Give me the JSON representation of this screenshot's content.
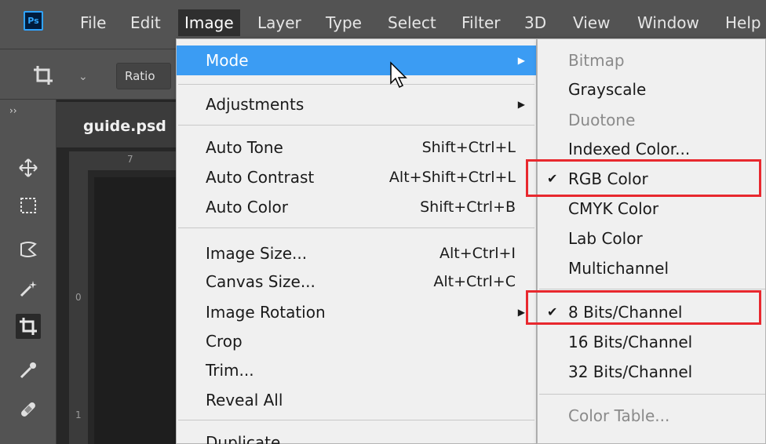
{
  "app_logo": "Ps",
  "menubar": {
    "items": [
      "File",
      "Edit",
      "Image",
      "Layer",
      "Type",
      "Select",
      "Filter",
      "3D",
      "View",
      "Window",
      "Help"
    ],
    "active_item": "Image"
  },
  "options_bar": {
    "ratio_label": "Ratio",
    "tool_icon": "crop-icon"
  },
  "document": {
    "tab_title": "guide.psd",
    "ruler_top_mark": "7",
    "ruler_left_marks": [
      "0",
      "1"
    ]
  },
  "toolbar": {
    "collapse_label": "››",
    "tools": [
      {
        "name": "move-tool-icon",
        "glyph": "✥"
      },
      {
        "name": "marquee-tool-icon",
        "glyph": "⬚"
      },
      {
        "name": "lasso-tool-icon",
        "glyph": "⌘"
      },
      {
        "name": "magic-wand-tool-icon",
        "glyph": "✦"
      },
      {
        "name": "crop-tool-icon",
        "glyph": "⌗"
      },
      {
        "name": "eyedropper-tool-icon",
        "glyph": "✎"
      },
      {
        "name": "healing-brush-tool-icon",
        "glyph": "✚"
      }
    ],
    "selected_tool": "crop-tool-icon"
  },
  "image_menu": {
    "items": [
      {
        "label": "Mode",
        "shortcut": "",
        "submenu": true,
        "highlighted": true
      },
      {
        "label": "Adjustments",
        "shortcut": "",
        "submenu": true,
        "highlighted": false
      },
      {
        "label": "Auto Tone",
        "shortcut": "Shift+Ctrl+L",
        "submenu": false
      },
      {
        "label": "Auto Contrast",
        "shortcut": "Alt+Shift+Ctrl+L",
        "submenu": false
      },
      {
        "label": "Auto Color",
        "shortcut": "Shift+Ctrl+B",
        "submenu": false
      },
      {
        "label": "Image Size...",
        "shortcut": "Alt+Ctrl+I",
        "submenu": false
      },
      {
        "label": "Canvas Size...",
        "shortcut": "Alt+Ctrl+C",
        "submenu": false
      },
      {
        "label": "Image Rotation",
        "shortcut": "",
        "submenu": true
      },
      {
        "label": "Crop",
        "shortcut": "",
        "submenu": false
      },
      {
        "label": "Trim...",
        "shortcut": "",
        "submenu": false
      },
      {
        "label": "Reveal All",
        "shortcut": "",
        "submenu": false
      },
      {
        "label": "Duplicate...",
        "shortcut": "",
        "submenu": false
      }
    ]
  },
  "mode_submenu": {
    "items": [
      {
        "label": "Bitmap",
        "disabled": true,
        "checked": false
      },
      {
        "label": "Grayscale",
        "disabled": false,
        "checked": false
      },
      {
        "label": "Duotone",
        "disabled": true,
        "checked": false
      },
      {
        "label": "Indexed Color...",
        "disabled": false,
        "checked": false
      },
      {
        "label": "RGB Color",
        "disabled": false,
        "checked": true
      },
      {
        "label": "CMYK Color",
        "disabled": false,
        "checked": false
      },
      {
        "label": "Lab Color",
        "disabled": false,
        "checked": false
      },
      {
        "label": "Multichannel",
        "disabled": false,
        "checked": false
      },
      {
        "label": "8 Bits/Channel",
        "disabled": false,
        "checked": true
      },
      {
        "label": "16 Bits/Channel",
        "disabled": false,
        "checked": false
      },
      {
        "label": "32 Bits/Channel",
        "disabled": false,
        "checked": false
      },
      {
        "label": "Color Table...",
        "disabled": true,
        "checked": false
      }
    ],
    "check_glyph": "✔"
  },
  "colors": {
    "highlight": "#3b9cf3",
    "annotation_red": "#e8282e",
    "ui_gray": "#535353"
  }
}
